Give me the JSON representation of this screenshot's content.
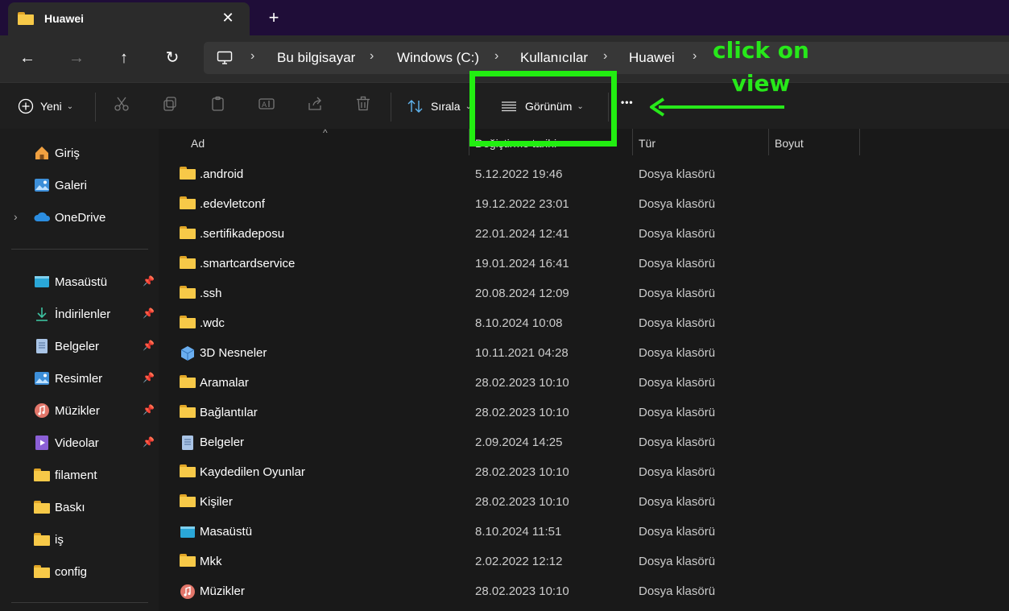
{
  "window": {
    "tab_title": "Huawei",
    "close_glyph": "✕",
    "new_tab_glyph": "+"
  },
  "nav": {
    "back_glyph": "←",
    "forward_glyph": "→",
    "up_glyph": "↑",
    "refresh_glyph": "↻",
    "breadcrumbs": [
      "Bu bilgisayar",
      "Windows (C:)",
      "Kullanıcılar",
      "Huawei"
    ],
    "separator": "›"
  },
  "toolbar": {
    "new_label": "Yeni",
    "sort_label": "Sırala",
    "view_label": "Görünüm",
    "more_glyph": "•••"
  },
  "sidebar": {
    "top_items": [
      {
        "label": "Giriş",
        "icon": "home-icon"
      },
      {
        "label": "Galeri",
        "icon": "gallery-icon"
      },
      {
        "label": "OneDrive",
        "icon": "onedrive-icon"
      }
    ],
    "pinned": [
      {
        "label": "Masaüstü",
        "icon": "desktop-icon"
      },
      {
        "label": "İndirilenler",
        "icon": "download-icon"
      },
      {
        "label": "Belgeler",
        "icon": "document-icon"
      },
      {
        "label": "Resimler",
        "icon": "pictures-icon"
      },
      {
        "label": "Müzikler",
        "icon": "music-icon"
      },
      {
        "label": "Videolar",
        "icon": "video-icon"
      }
    ],
    "folders": [
      {
        "label": "filament"
      },
      {
        "label": "Baskı"
      },
      {
        "label": "iş"
      },
      {
        "label": "config"
      }
    ]
  },
  "columns": {
    "name": "Ad",
    "date": "Değiştirme tarihi",
    "type": "Tür",
    "size": "Boyut"
  },
  "files": [
    {
      "name": ".android",
      "date": "5.12.2022 19:46",
      "type": "Dosya klasörü",
      "icon": "folder-icon"
    },
    {
      "name": ".edevletconf",
      "date": "19.12.2022 23:01",
      "type": "Dosya klasörü",
      "icon": "folder-icon"
    },
    {
      "name": ".sertifikadeposu",
      "date": "22.01.2024 12:41",
      "type": "Dosya klasörü",
      "icon": "folder-icon"
    },
    {
      "name": ".smartcardservice",
      "date": "19.01.2024 16:41",
      "type": "Dosya klasörü",
      "icon": "folder-icon"
    },
    {
      "name": ".ssh",
      "date": "20.08.2024 12:09",
      "type": "Dosya klasörü",
      "icon": "folder-icon"
    },
    {
      "name": ".wdc",
      "date": "8.10.2024 10:08",
      "type": "Dosya klasörü",
      "icon": "folder-icon"
    },
    {
      "name": "3D Nesneler",
      "date": "10.11.2021 04:28",
      "type": "Dosya klasörü",
      "icon": "3d-objects-icon"
    },
    {
      "name": "Aramalar",
      "date": "28.02.2023 10:10",
      "type": "Dosya klasörü",
      "icon": "folder-icon"
    },
    {
      "name": "Bağlantılar",
      "date": "28.02.2023 10:10",
      "type": "Dosya klasörü",
      "icon": "folder-icon"
    },
    {
      "name": "Belgeler",
      "date": "2.09.2024 14:25",
      "type": "Dosya klasörü",
      "icon": "document-icon"
    },
    {
      "name": "Kaydedilen Oyunlar",
      "date": "28.02.2023 10:10",
      "type": "Dosya klasörü",
      "icon": "folder-icon"
    },
    {
      "name": "Kişiler",
      "date": "28.02.2023 10:10",
      "type": "Dosya klasörü",
      "icon": "folder-icon"
    },
    {
      "name": "Masaüstü",
      "date": "8.10.2024 11:51",
      "type": "Dosya klasörü",
      "icon": "desktop-icon"
    },
    {
      "name": "Mkk",
      "date": "2.02.2022 12:12",
      "type": "Dosya klasörü",
      "icon": "folder-icon"
    },
    {
      "name": "Müzikler",
      "date": "28.02.2023 10:10",
      "type": "Dosya klasörü",
      "icon": "music-icon"
    }
  ],
  "annotation": {
    "text": "click on view",
    "color": "#22ee11"
  }
}
